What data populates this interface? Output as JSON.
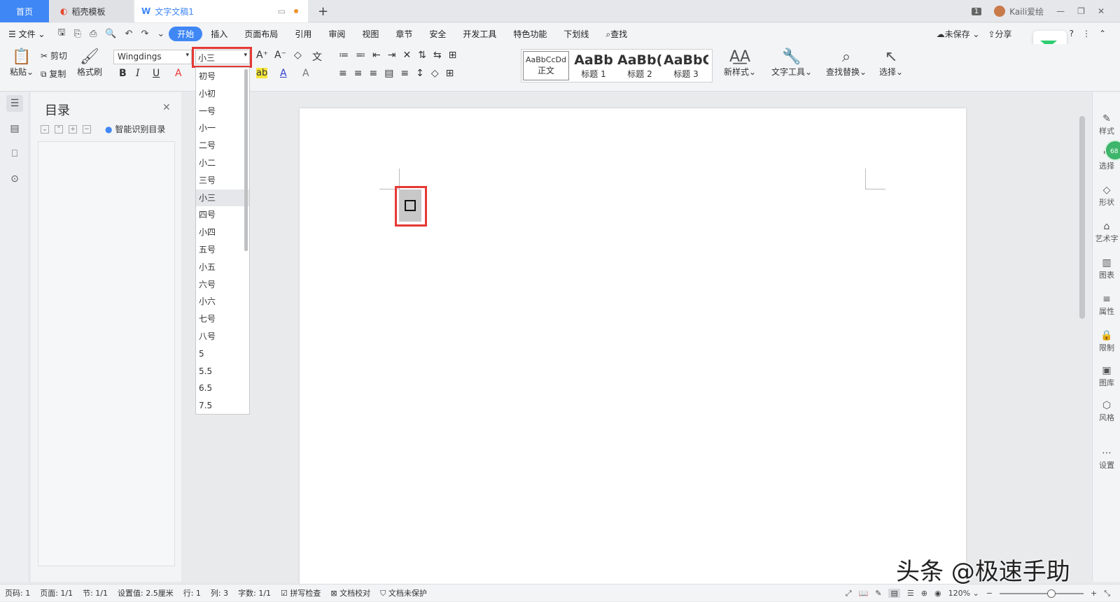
{
  "tabs": {
    "home": "首页",
    "template": "稻壳模板",
    "document": "文字文稿1"
  },
  "titlebar": {
    "page_count": "1",
    "user": "Kaili爱绘"
  },
  "menu": {
    "file": "文件",
    "items": [
      "开始",
      "插入",
      "页面布局",
      "引用",
      "审阅",
      "视图",
      "章节",
      "安全",
      "开发工具",
      "特色功能",
      "下划线"
    ],
    "search": "查找",
    "unsaved": "未保存",
    "share": "分享"
  },
  "ribbon": {
    "paste": "粘贴",
    "cut": "剪切",
    "copy": "复制",
    "format_painter": "格式刷",
    "font_name": "Wingdings",
    "font_size": "小三",
    "styles": [
      {
        "sample": "AaBbCcDd",
        "name": "正文"
      },
      {
        "sample": "AaBb",
        "name": "标题 1"
      },
      {
        "sample": "AaBb(",
        "name": "标题 2"
      },
      {
        "sample": "AaBbC(",
        "name": "标题 3"
      }
    ],
    "new_style": "新样式",
    "text_tools": "文字工具",
    "find_replace": "查找替换",
    "select": "选择"
  },
  "toc": {
    "title": "目录",
    "smart": "智能识别目录"
  },
  "font_sizes": [
    "初号",
    "小初",
    "一号",
    "小一",
    "二号",
    "小二",
    "三号",
    "小三",
    "四号",
    "小四",
    "五号",
    "小五",
    "六号",
    "小六",
    "七号",
    "八号",
    "5",
    "5.5",
    "6.5",
    "7.5"
  ],
  "selected_font_size": "小三",
  "right_panel": [
    "样式",
    "选择",
    "形状",
    "艺术字",
    "图表",
    "属性",
    "限制",
    "图库",
    "风格",
    "设置"
  ],
  "badge": "68",
  "status": {
    "page": "页码: 1",
    "pages": "页面: 1/1",
    "section": "节: 1/1",
    "setting": "设置值: 2.5厘米",
    "row": "行: 1",
    "col": "列: 3",
    "words": "字数: 1/1",
    "spell": "拼写检查",
    "proof": "文档校对",
    "protect": "文档未保护",
    "zoom": "120%"
  },
  "watermark": "头条 @极速手助"
}
